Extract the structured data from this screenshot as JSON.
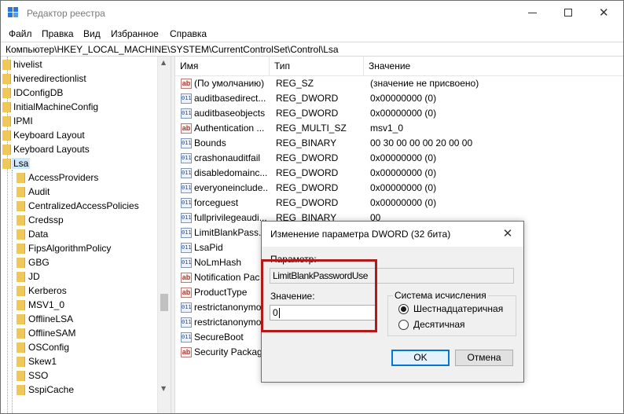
{
  "window": {
    "title": "Редактор реестра",
    "icon": "regedit-icon"
  },
  "menu": {
    "items": [
      {
        "label": "Файл"
      },
      {
        "label": "Правка"
      },
      {
        "label": "Вид"
      },
      {
        "label": "Избранное"
      },
      {
        "label": "Справка"
      }
    ]
  },
  "address": {
    "path": "Компьютер\\HKEY_LOCAL_MACHINE\\SYSTEM\\CurrentControlSet\\Control\\Lsa"
  },
  "tree": {
    "items": [
      {
        "label": "hivelist",
        "level": 0
      },
      {
        "label": "hiveredirectionlist",
        "level": 0
      },
      {
        "label": "IDConfigDB",
        "level": 0
      },
      {
        "label": "InitialMachineConfig",
        "level": 0
      },
      {
        "label": "IPMI",
        "level": 0
      },
      {
        "label": "Keyboard Layout",
        "level": 0
      },
      {
        "label": "Keyboard Layouts",
        "level": 0
      },
      {
        "label": "Lsa",
        "level": 0,
        "selected": true
      },
      {
        "label": "AccessProviders",
        "level": 1
      },
      {
        "label": "Audit",
        "level": 1
      },
      {
        "label": "CentralizedAccessPolicies",
        "level": 1
      },
      {
        "label": "Credssp",
        "level": 1
      },
      {
        "label": "Data",
        "level": 1
      },
      {
        "label": "FipsAlgorithmPolicy",
        "level": 1
      },
      {
        "label": "GBG",
        "level": 1
      },
      {
        "label": "JD",
        "level": 1
      },
      {
        "label": "Kerberos",
        "level": 1
      },
      {
        "label": "MSV1_0",
        "level": 1
      },
      {
        "label": "OfflineLSA",
        "level": 1
      },
      {
        "label": "OfflineSAM",
        "level": 1
      },
      {
        "label": "OSConfig",
        "level": 1
      },
      {
        "label": "Skew1",
        "level": 1
      },
      {
        "label": "SSO",
        "level": 1
      },
      {
        "label": "SspiCache",
        "level": 1
      }
    ]
  },
  "list": {
    "columns": [
      "Имя",
      "Тип",
      "Значение"
    ],
    "rows": [
      {
        "icon": "ab",
        "name": "(По умолчанию)",
        "type": "REG_SZ",
        "data": "(значение не присвоено)"
      },
      {
        "icon": "bin",
        "name": "auditbasedirect...",
        "type": "REG_DWORD",
        "data": "0x00000000 (0)"
      },
      {
        "icon": "bin",
        "name": "auditbaseobjects",
        "type": "REG_DWORD",
        "data": "0x00000000 (0)"
      },
      {
        "icon": "ab",
        "name": "Authentication ...",
        "type": "REG_MULTI_SZ",
        "data": "msv1_0"
      },
      {
        "icon": "bin",
        "name": "Bounds",
        "type": "REG_BINARY",
        "data": "00 30 00 00 00 20 00 00"
      },
      {
        "icon": "bin",
        "name": "crashonauditfail",
        "type": "REG_DWORD",
        "data": "0x00000000 (0)"
      },
      {
        "icon": "bin",
        "name": "disabledomainc...",
        "type": "REG_DWORD",
        "data": "0x00000000 (0)"
      },
      {
        "icon": "bin",
        "name": "everyoneinclude...",
        "type": "REG_DWORD",
        "data": "0x00000000 (0)"
      },
      {
        "icon": "bin",
        "name": "forceguest",
        "type": "REG_DWORD",
        "data": "0x00000000 (0)"
      },
      {
        "icon": "bin",
        "name": "fullprivilegeaudi...",
        "type": "REG_BINARY",
        "data": "00"
      },
      {
        "icon": "bin",
        "name": "LimitBlankPass...",
        "type": "",
        "data": ""
      },
      {
        "icon": "bin",
        "name": "LsaPid",
        "type": "",
        "data": ""
      },
      {
        "icon": "bin",
        "name": "NoLmHash",
        "type": "",
        "data": ""
      },
      {
        "icon": "ab",
        "name": "Notification Pac",
        "type": "",
        "data": ""
      },
      {
        "icon": "ab",
        "name": "ProductType",
        "type": "",
        "data": ""
      },
      {
        "icon": "bin",
        "name": "restrictanonymo",
        "type": "",
        "data": ""
      },
      {
        "icon": "bin",
        "name": "restrictanonymo",
        "type": "",
        "data": ""
      },
      {
        "icon": "bin",
        "name": "SecureBoot",
        "type": "",
        "data": ""
      },
      {
        "icon": "ab",
        "name": "Security Package",
        "type": "",
        "data": ""
      }
    ]
  },
  "dialog": {
    "title": "Изменение параметра DWORD (32 бита)",
    "param_label": "Параметр:",
    "param_value": "LimitBlankPasswordUse",
    "value_label": "Значение:",
    "value": "0",
    "base_group_title": "Система исчисления",
    "radio_hex": "Шестнадцатеричная",
    "radio_dec": "Десятичная",
    "radio_selected": "hex",
    "ok_label": "OK",
    "cancel_label": "Отмена"
  },
  "colors": {
    "accent": "#0078d7",
    "selection": "#cce8ff",
    "highlight_frame": "#b21a1a",
    "folder": "#f0c85a"
  }
}
